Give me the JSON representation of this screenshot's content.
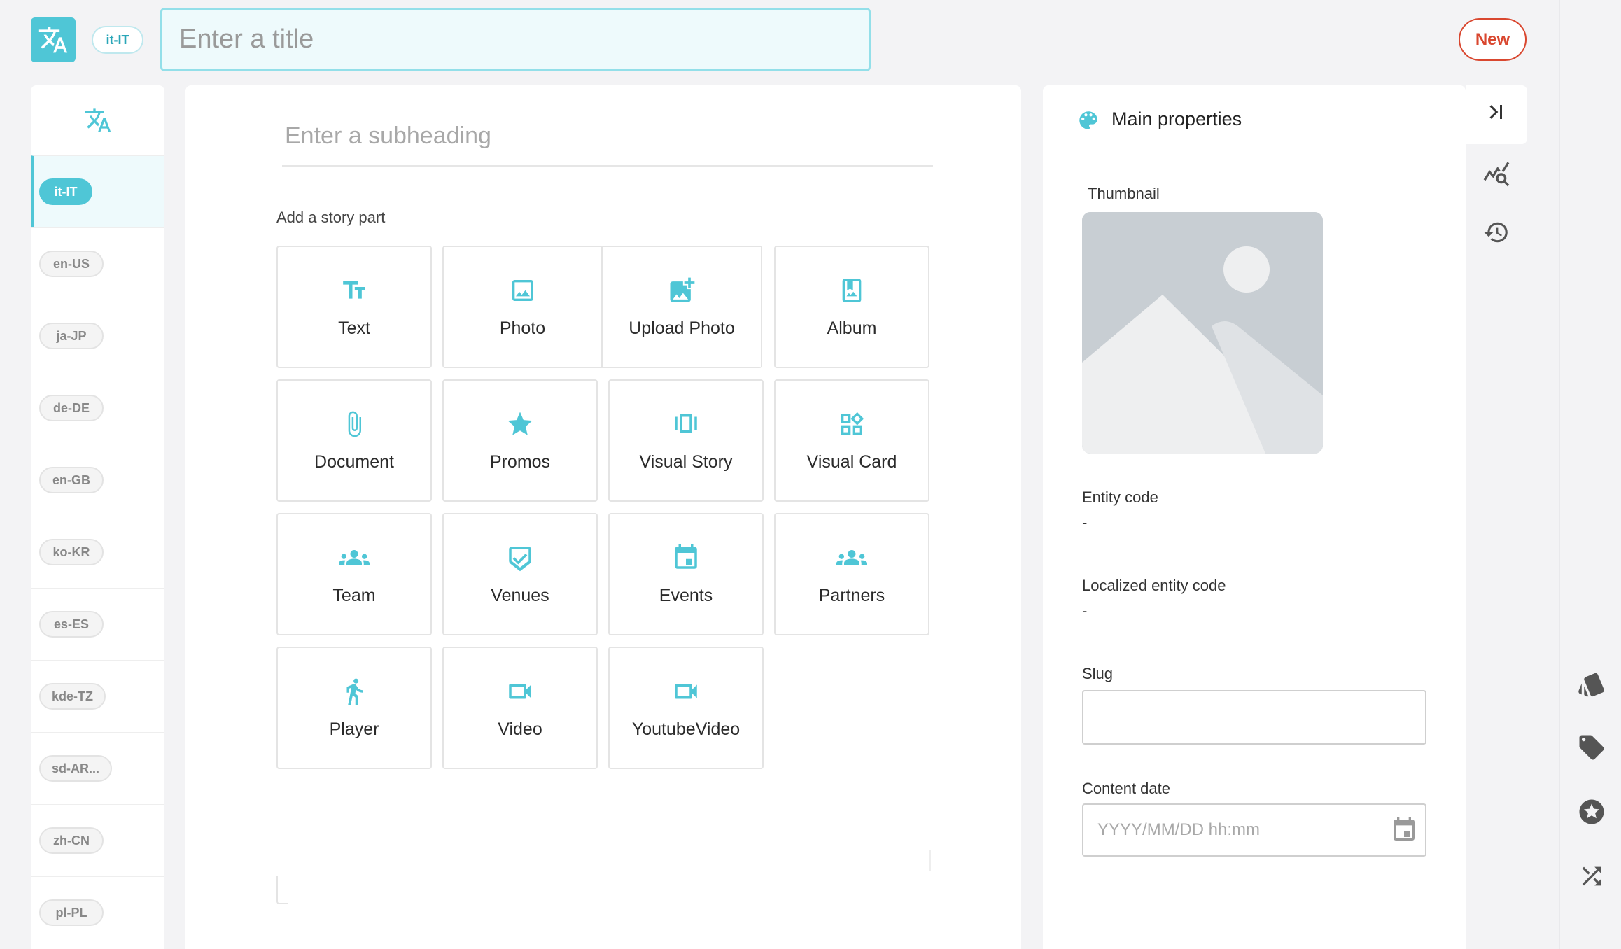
{
  "header": {
    "locale_badge": "it-IT",
    "title_placeholder": "Enter a title",
    "new_button": "New"
  },
  "locales": {
    "items": [
      "it-IT",
      "en-US",
      "ja-JP",
      "de-DE",
      "en-GB",
      "ko-KR",
      "es-ES",
      "kde-TZ",
      "sd-AR...",
      "zh-CN",
      "pl-PL"
    ],
    "active": "it-IT"
  },
  "editor": {
    "subheading_placeholder": "Enter a subheading",
    "add_story_part_label": "Add a story part",
    "tiles": [
      {
        "label": "Text",
        "icon": "text-icon"
      },
      {
        "label": "Photo",
        "icon": "photo-icon"
      },
      {
        "label": "Upload Photo",
        "icon": "upload-photo-icon"
      },
      {
        "label": "Album",
        "icon": "album-icon"
      },
      {
        "label": "Document",
        "icon": "paperclip-icon"
      },
      {
        "label": "Promos",
        "icon": "star-icon"
      },
      {
        "label": "Visual Story",
        "icon": "carousel-icon"
      },
      {
        "label": "Visual Card",
        "icon": "widgets-icon"
      },
      {
        "label": "Team",
        "icon": "group-icon"
      },
      {
        "label": "Venues",
        "icon": "shield-check-icon"
      },
      {
        "label": "Events",
        "icon": "calendar-icon"
      },
      {
        "label": "Partners",
        "icon": "group-icon"
      },
      {
        "label": "Player",
        "icon": "person-icon"
      },
      {
        "label": "Video",
        "icon": "video-camera-icon"
      },
      {
        "label": "YoutubeVideo",
        "icon": "video-camera-icon"
      }
    ]
  },
  "properties": {
    "title": "Main properties",
    "thumbnail_label": "Thumbnail",
    "entity_code_label": "Entity code",
    "entity_code_value": "-",
    "localized_entity_code_label": "Localized entity code",
    "localized_entity_code_value": "-",
    "slug_label": "Slug",
    "slug_value": "",
    "content_date_label": "Content date",
    "content_date_placeholder": "YYYY/MM/DD hh:mm"
  },
  "right_rail": {
    "icons": [
      "collapse-panel-icon",
      "insights-search-icon",
      "history-icon",
      "cards-icon",
      "tag-icon",
      "star-badge-icon",
      "shuffle-icon"
    ]
  },
  "colors": {
    "accent": "#4fc6d6",
    "new_button": "#d9472f"
  }
}
